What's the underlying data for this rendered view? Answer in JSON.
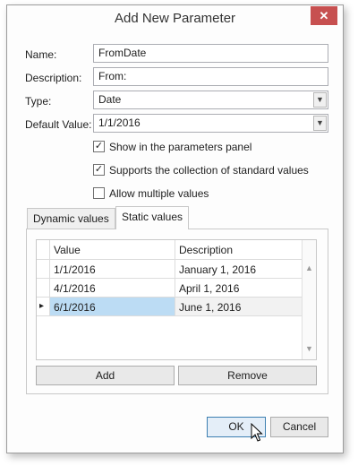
{
  "dialog": {
    "title": "Add New Parameter",
    "close_glyph": "✕"
  },
  "form": {
    "name_label": "Name:",
    "name_value": "FromDate",
    "description_label": "Description:",
    "description_value": "From:",
    "type_label": "Type:",
    "type_value": "Date",
    "default_label": "Default Value:",
    "default_value": "1/1/2016"
  },
  "options": {
    "show_in_panel": {
      "label": "Show in the parameters panel",
      "checked": true
    },
    "supports_standard_values": {
      "label": "Supports the collection of standard values",
      "checked": true
    },
    "allow_multiple": {
      "label": "Allow multiple values",
      "checked": false
    }
  },
  "tabs": {
    "dynamic": "Dynamic values",
    "static": "Static values",
    "active": "static"
  },
  "grid": {
    "columns": [
      "Value",
      "Description"
    ],
    "rows": [
      {
        "value": "1/1/2016",
        "description": "January 1, 2016",
        "current": false
      },
      {
        "value": "4/1/2016",
        "description": "April 1, 2016",
        "current": false
      },
      {
        "value": "6/1/2016",
        "description": "June 1, 2016",
        "current": true
      }
    ],
    "current_row_glyph": "▸"
  },
  "grid_buttons": {
    "add": "Add",
    "remove": "Remove"
  },
  "footer": {
    "ok": "OK",
    "cancel": "Cancel"
  },
  "colors": {
    "selection": "#bcdcf4",
    "close": "#c75050",
    "primary_border": "#3c7fb1"
  }
}
